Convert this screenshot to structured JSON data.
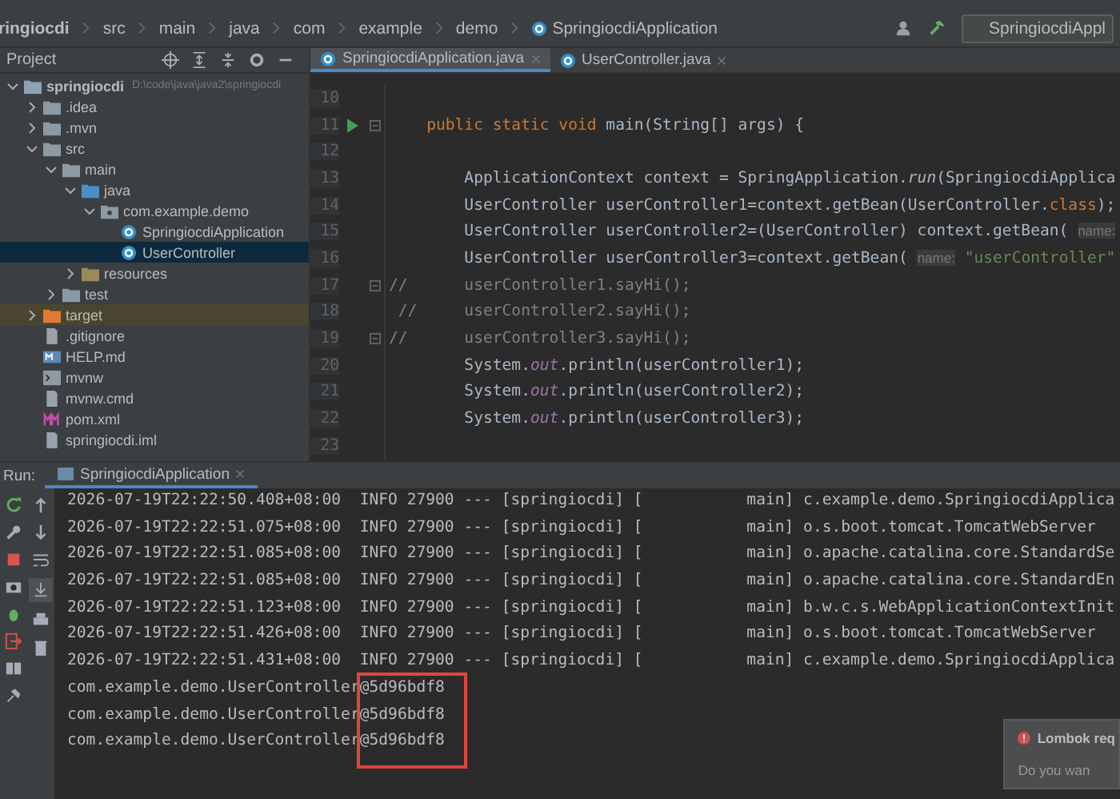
{
  "breadcrumb": [
    "ringiocdi",
    "src",
    "main",
    "java",
    "com",
    "example",
    "demo",
    "SpringiocdiApplication"
  ],
  "run_config": "SpringiocdiAppl",
  "project_panel": {
    "title": "Project"
  },
  "tree": [
    {
      "label": "springiocdi",
      "note": "D:\\code\\java\\java2\\springiocdi",
      "kind": "module",
      "expanded": true,
      "selected": false,
      "children": [
        {
          "label": ".idea",
          "kind": "folder",
          "expanded": false,
          "selected": false
        },
        {
          "label": ".mvn",
          "kind": "folder",
          "expanded": false,
          "selected": false
        },
        {
          "label": "src",
          "kind": "folder",
          "expanded": true,
          "selected": false,
          "children": [
            {
              "label": "main",
              "kind": "folder",
              "expanded": true,
              "selected": false,
              "children": [
                {
                  "label": "java",
                  "kind": "source",
                  "expanded": true,
                  "selected": false,
                  "children": [
                    {
                      "label": "com.example.demo",
                      "kind": "package",
                      "expanded": true,
                      "selected": false,
                      "children": [
                        {
                          "label": "SpringiocdiApplication",
                          "kind": "class",
                          "selected": false
                        },
                        {
                          "label": "UserController",
                          "kind": "class",
                          "selected": true
                        }
                      ]
                    }
                  ]
                },
                {
                  "label": "resources",
                  "kind": "resources",
                  "expanded": false,
                  "selected": false
                }
              ]
            },
            {
              "label": "test",
              "kind": "folder",
              "expanded": false,
              "selected": false
            }
          ]
        },
        {
          "label": "target",
          "kind": "excluded",
          "expanded": false,
          "selected": false
        },
        {
          "label": ".gitignore",
          "kind": "file",
          "selected": false
        },
        {
          "label": "HELP.md",
          "kind": "markdown",
          "selected": false
        },
        {
          "label": "mvnw",
          "kind": "script",
          "selected": false
        },
        {
          "label": "mvnw.cmd",
          "kind": "file",
          "selected": false
        },
        {
          "label": "pom.xml",
          "kind": "maven",
          "selected": false
        },
        {
          "label": "springiocdi.iml",
          "kind": "file",
          "selected": false
        }
      ]
    }
  ],
  "editor_tabs": [
    {
      "label": "SpringiocdiApplication.java",
      "selected": true
    },
    {
      "label": "UserController.java",
      "selected": false
    }
  ],
  "code": [
    {
      "number": "10"
    },
    {
      "number": "11",
      "run": true,
      "fold": true,
      "tokens": [
        {
          "kind": "kw",
          "text": "    public static void "
        },
        {
          "kind": "plain",
          "text": "main(String[] args) {"
        }
      ]
    },
    {
      "number": "12"
    },
    {
      "number": "13",
      "tokens": [
        {
          "kind": "plain",
          "text": "        ApplicationContext context = SpringApplication."
        },
        {
          "kind": "italic",
          "text": "run"
        },
        {
          "kind": "plain",
          "text": "(SpringiocdiApplica"
        }
      ]
    },
    {
      "number": "14",
      "tokens": [
        {
          "kind": "plain",
          "text": "        UserController userController1=context.getBean(UserController."
        },
        {
          "kind": "kw",
          "text": "class"
        },
        {
          "kind": "plain",
          "text": ");"
        }
      ]
    },
    {
      "number": "15",
      "tokens": [
        {
          "kind": "plain",
          "text": "        UserController userController2=(UserController) context.getBean( "
        },
        {
          "kind": "hint",
          "text": "name:"
        }
      ]
    },
    {
      "number": "16",
      "tokens": [
        {
          "kind": "plain",
          "text": "        UserController userController3=context.getBean( "
        },
        {
          "kind": "hint",
          "text": "name:"
        },
        {
          "kind": "string",
          "text": " \"userController\""
        }
      ]
    },
    {
      "number": "17",
      "fold": true,
      "tokens": [
        {
          "kind": "comment",
          "text": "//      userController1.sayHi();"
        }
      ]
    },
    {
      "number": "18",
      "tokens": [
        {
          "kind": "comment",
          "text": " //     userController2.sayHi();"
        }
      ]
    },
    {
      "number": "19",
      "fold": true,
      "tokens": [
        {
          "kind": "comment",
          "text": "//      userController3.sayHi();"
        }
      ]
    },
    {
      "number": "20",
      "tokens": [
        {
          "kind": "plain",
          "text": "        System."
        },
        {
          "kind": "field",
          "text": "out"
        },
        {
          "kind": "plain",
          "text": ".println(userController1);"
        }
      ]
    },
    {
      "number": "21",
      "tokens": [
        {
          "kind": "plain",
          "text": "        System."
        },
        {
          "kind": "field",
          "text": "out"
        },
        {
          "kind": "plain",
          "text": ".println(userController2);"
        }
      ]
    },
    {
      "number": "22",
      "tokens": [
        {
          "kind": "plain",
          "text": "        System."
        },
        {
          "kind": "field",
          "text": "out"
        },
        {
          "kind": "plain",
          "text": ".println(userController3);"
        }
      ]
    },
    {
      "number": "23"
    }
  ],
  "run_panel": {
    "label": "Run:",
    "tab": "SpringiocdiApplication"
  },
  "console": [
    "2026-07-19T22:22:50.408+08:00  INFO 27900 --- [springiocdi] [           main] c.example.demo.SpringiocdiApplica",
    "2026-07-19T22:22:51.075+08:00  INFO 27900 --- [springiocdi] [           main] o.s.boot.tomcat.TomcatWebServer",
    "2026-07-19T22:22:51.085+08:00  INFO 27900 --- [springiocdi] [           main] o.apache.catalina.core.StandardSe",
    "2026-07-19T22:22:51.085+08:00  INFO 27900 --- [springiocdi] [           main] o.apache.catalina.core.StandardEn",
    "2026-07-19T22:22:51.123+08:00  INFO 27900 --- [springiocdi] [           main] b.w.c.s.WebApplicationContextInit",
    "2026-07-19T22:22:51.426+08:00  INFO 27900 --- [springiocdi] [           main] o.s.boot.tomcat.TomcatWebServer",
    "2026-07-19T22:22:51.431+08:00  INFO 27900 --- [springiocdi] [           main] c.example.demo.SpringiocdiApplica"
  ],
  "output": [
    {
      "prefix": "com.example.demo.UserController",
      "hash": "@5d96bdf8"
    },
    {
      "prefix": "com.example.demo.UserController",
      "hash": "@5d96bdf8"
    },
    {
      "prefix": "com.example.demo.UserController",
      "hash": "@5d96bdf8"
    }
  ],
  "notification": {
    "title": "Lombok req",
    "body": "Do you wan"
  }
}
